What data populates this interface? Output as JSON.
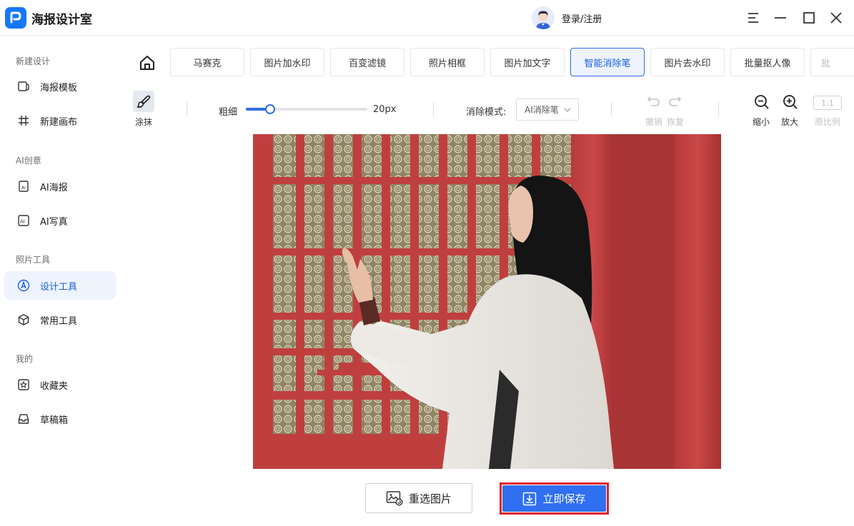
{
  "app": {
    "title": "海报设计室",
    "login_label": "登录/注册"
  },
  "sidebar": {
    "groups": [
      {
        "label": "新建设计",
        "items": [
          {
            "label": "海报模板",
            "icon": "poster-template-icon"
          },
          {
            "label": "新建画布",
            "icon": "canvas-grid-icon"
          }
        ]
      },
      {
        "label": "AI创意",
        "items": [
          {
            "label": "AI海报",
            "icon": "ai-poster-icon"
          },
          {
            "label": "AI写真",
            "icon": "ai-portrait-icon"
          }
        ]
      },
      {
        "label": "照片工具",
        "items": [
          {
            "label": "设计工具",
            "icon": "design-tool-icon",
            "active": true
          },
          {
            "label": "常用工具",
            "icon": "cube-icon"
          }
        ]
      },
      {
        "label": "我的",
        "items": [
          {
            "label": "收藏夹",
            "icon": "favorites-icon"
          },
          {
            "label": "草稿箱",
            "icon": "drafts-icon"
          }
        ]
      }
    ]
  },
  "tabs": [
    {
      "label": "马赛克"
    },
    {
      "label": "图片加水印"
    },
    {
      "label": "百变滤镜"
    },
    {
      "label": "照片相框"
    },
    {
      "label": "图片加文字"
    },
    {
      "label": "智能消除笔",
      "active": true
    },
    {
      "label": "图片去水印"
    },
    {
      "label": "批量抠人像"
    },
    {
      "label": "批"
    }
  ],
  "toolbar": {
    "brush_label": "涂抹",
    "thickness_label": "粗细",
    "thickness_value": "20px",
    "thickness_level": 0.2,
    "mode_label": "消除模式:",
    "mode_value": "AI消除笔",
    "undo_label": "撤销",
    "redo_label": "恢复",
    "zoom_out_label": "缩小",
    "zoom_in_label": "放大",
    "ratio_text": "1:1",
    "ratio_label": "原比例"
  },
  "actions": {
    "reselect_label": "重选图片",
    "save_label": "立即保存"
  },
  "colors": {
    "accent": "#2f6ff0",
    "active_bg": "#eef3fe",
    "highlight_border": "#e0202a"
  }
}
